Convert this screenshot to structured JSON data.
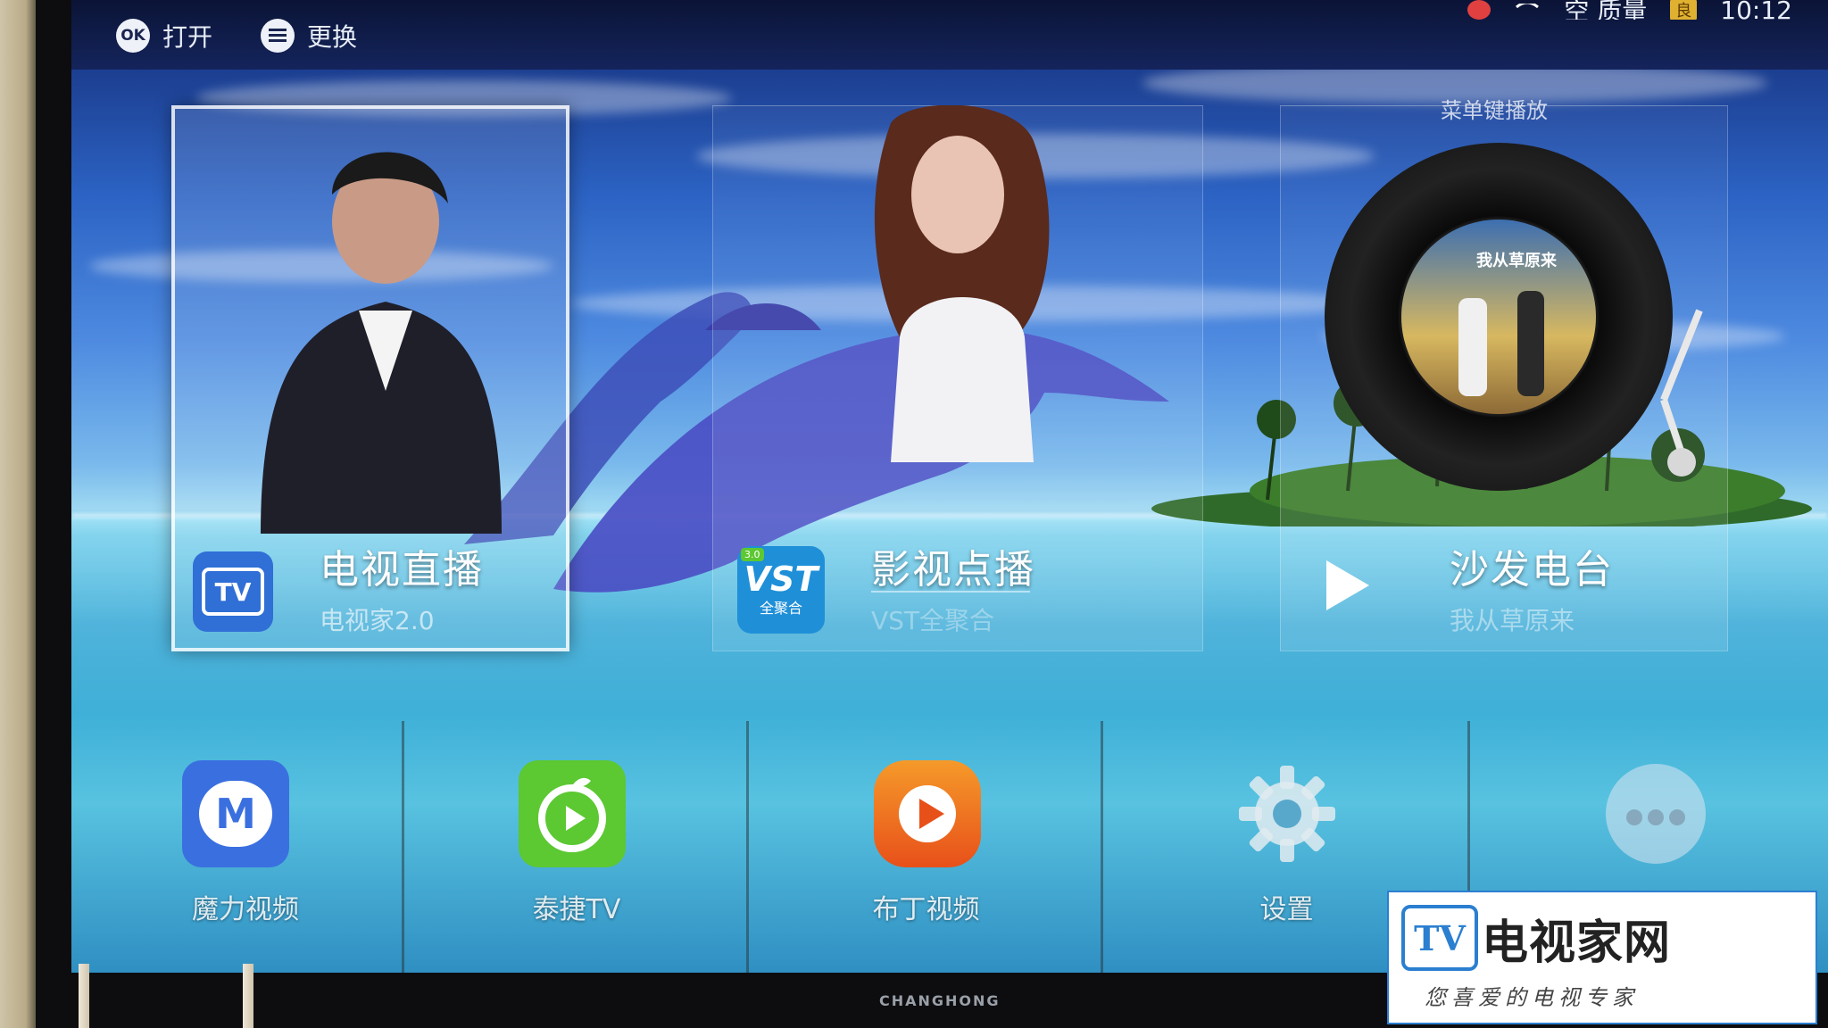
{
  "status_bar": {
    "ok_hint": {
      "badge": "OK",
      "label": "打开"
    },
    "menu_hint": {
      "label": "更换"
    },
    "quality_label": "空 质量",
    "quality_badge": "良",
    "time": "10:12"
  },
  "feature_tiles": [
    {
      "title": "电视直播",
      "subtitle": "电视家2.0",
      "icon": "tv-icon",
      "icon_text": "TV",
      "focused": true
    },
    {
      "title": "影视点播",
      "subtitle": "VST全聚合",
      "icon": "vst-icon",
      "icon_text": "VST",
      "icon_subtext": "全聚合",
      "icon_version": "3.0"
    },
    {
      "title": "沙发电台",
      "subtitle": "我从草原来",
      "icon": "play-icon",
      "caption": "菜单键播放",
      "album_text": "我从草原来"
    }
  ],
  "apps": [
    {
      "label": "魔力视频",
      "icon": "moli-video-icon",
      "icon_text": "M"
    },
    {
      "label": "泰捷TV",
      "icon": "taijie-tv-icon"
    },
    {
      "label": "布丁视频",
      "icon": "play-cushion-icon"
    },
    {
      "label": "设置",
      "icon": "gear-icon"
    },
    {
      "label": "更多",
      "icon": "more-icon"
    }
  ],
  "watermark": {
    "logo_text": "TV",
    "name": "电视家网",
    "slogan": "您喜爱的电视专家"
  },
  "brand": "CHANGHONG",
  "colors": {
    "status_bar": "#0b1436",
    "tv_icon_bg": "#2f6fd6",
    "vst_icon_bg": "#1f8fd8",
    "moli_icon_bg": "#3a6fe0",
    "taijie_icon_bg": "#5cc832",
    "play_icon_bg": "#f06a1c",
    "watermark_blue": "#2b7fd0"
  }
}
